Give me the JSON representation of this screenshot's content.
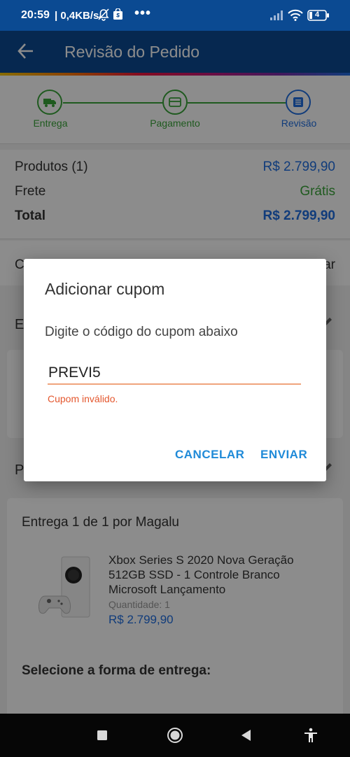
{
  "status_bar": {
    "time": "20:59",
    "net_speed": "| 0,4KB/s",
    "battery": "4",
    "dots": "•••"
  },
  "app_bar": {
    "title": "Revisão do Pedido"
  },
  "steps": [
    {
      "label": "Entrega"
    },
    {
      "label": "Pagamento"
    },
    {
      "label": "Revisão"
    }
  ],
  "summary": {
    "products_label": "Produtos (1)",
    "products_value": "R$ 2.799,90",
    "shipping_label": "Frete",
    "shipping_value": "Grátis",
    "total_label": "Total",
    "total_value": "R$ 2.799,90"
  },
  "coupon_row": {
    "left": "C",
    "right": "ar"
  },
  "address_section": {
    "title": "E"
  },
  "products_section": {
    "title": "P"
  },
  "delivery": {
    "title": "Entrega 1 de 1 por Magalu",
    "product_name": "Xbox Series S 2020 Nova Geração 512GB SSD - 1 Controle Branco Microsoft Lançamento",
    "quantity": "Quantidade:  1",
    "price": "R$ 2.799,90",
    "shipping_form_title": "Selecione a forma de entrega:"
  },
  "dialog": {
    "title": "Adicionar cupom",
    "instruction": "Digite o código do cupom abaixo",
    "input_value": "PREVI5",
    "error": "Cupom inválido.",
    "cancel_label": "CANCELAR",
    "send_label": "ENVIAR"
  },
  "colors": {
    "brand_blue": "#0b4a92",
    "link_blue": "#1f6ee0",
    "success_green": "#3aa53a",
    "error_orange": "#e4572e"
  }
}
